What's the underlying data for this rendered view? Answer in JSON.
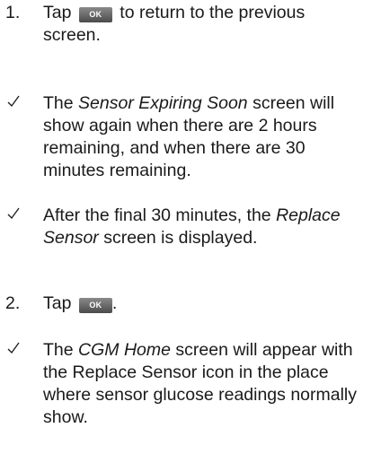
{
  "steps": [
    {
      "number": "1.",
      "before": "Tap",
      "button": "OK",
      "after": "to return to the previous screen."
    },
    {
      "number": "2.",
      "before": "Tap",
      "button": "OK",
      "after": "."
    }
  ],
  "notes": [
    {
      "prefix": "The ",
      "emph": "Sensor Expiring Soon",
      "suffix": " screen will show again when there are 2 hours remaining, and when there are 30 minutes remaining."
    },
    {
      "prefix": "After the final 30 minutes, the ",
      "emph": "Replace Sensor",
      "suffix": " screen is displayed."
    },
    {
      "prefix": "The ",
      "emph": "CGM Home",
      "suffix": " screen will appear with the Replace Sensor icon in the place where sensor glucose readings normally show."
    }
  ],
  "icons": {
    "check": "checkmark-icon",
    "button_color": "#6e6e6e"
  }
}
